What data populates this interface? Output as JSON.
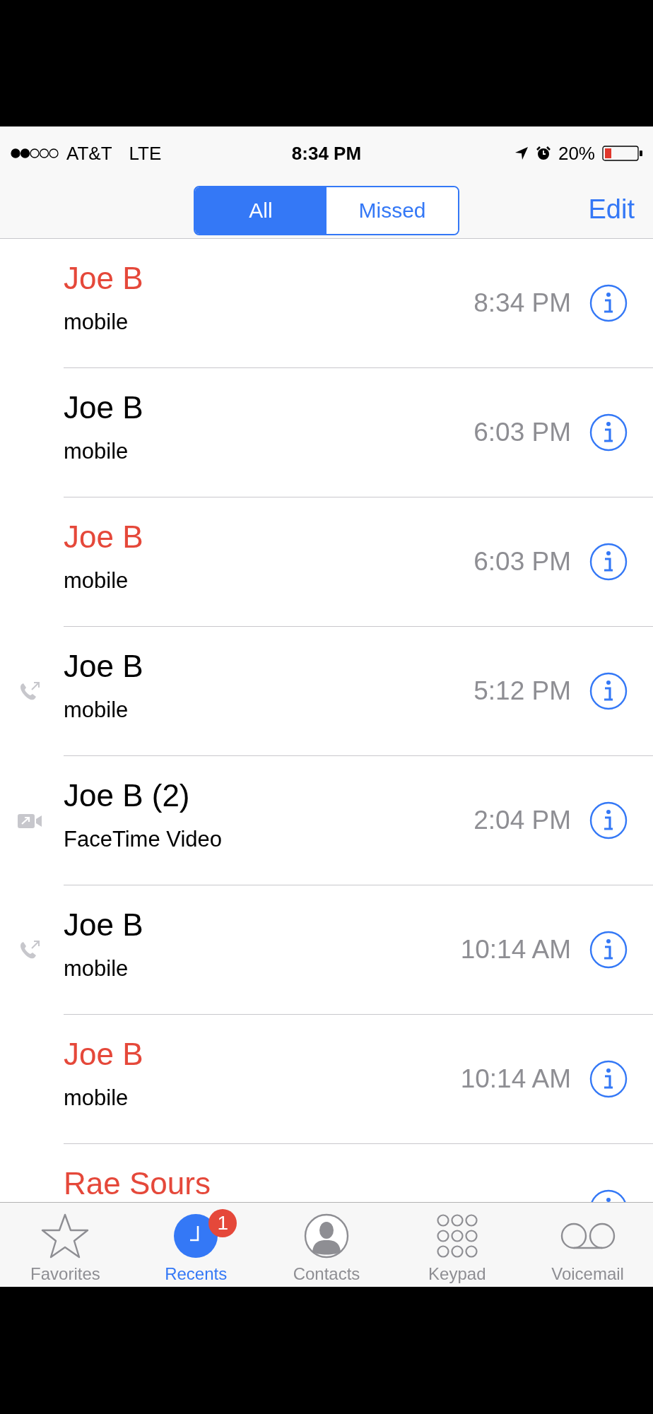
{
  "status_bar": {
    "carrier": "AT&T",
    "network": "LTE",
    "time": "8:34 PM",
    "battery": "20%"
  },
  "nav": {
    "segments": [
      {
        "label": "All",
        "selected": true
      },
      {
        "label": "Missed",
        "selected": false
      }
    ],
    "edit": "Edit"
  },
  "calls": [
    {
      "kind": "plain",
      "name": "Joe B",
      "missed": true,
      "detail": "mobile",
      "time": "8:34 PM"
    },
    {
      "kind": "plain",
      "name": "Joe B",
      "missed": false,
      "detail": "mobile",
      "time": "6:03 PM"
    },
    {
      "kind": "plain",
      "name": "Joe B",
      "missed": true,
      "detail": "mobile",
      "time": "6:03 PM"
    },
    {
      "kind": "outgoing",
      "name": "Joe B",
      "missed": false,
      "detail": "mobile",
      "time": "5:12 PM"
    },
    {
      "kind": "outgoing_video",
      "name": "Joe B (2)",
      "missed": false,
      "detail": "FaceTime Video",
      "time": "2:04 PM"
    },
    {
      "kind": "outgoing",
      "name": "Joe B",
      "missed": false,
      "detail": "mobile",
      "time": "10:14 AM"
    },
    {
      "kind": "plain",
      "name": "Joe B",
      "missed": true,
      "detail": "mobile",
      "time": "10:14 AM"
    },
    {
      "kind": "plain",
      "name": "Rae Sours",
      "missed": true
    }
  ],
  "tabs": [
    {
      "label": "Favorites",
      "selected": false
    },
    {
      "label": "Recents",
      "selected": true,
      "badge": "1"
    },
    {
      "label": "Contacts",
      "selected": false
    },
    {
      "label": "Keypad",
      "selected": false
    },
    {
      "label": "Voicemail",
      "selected": false
    }
  ]
}
